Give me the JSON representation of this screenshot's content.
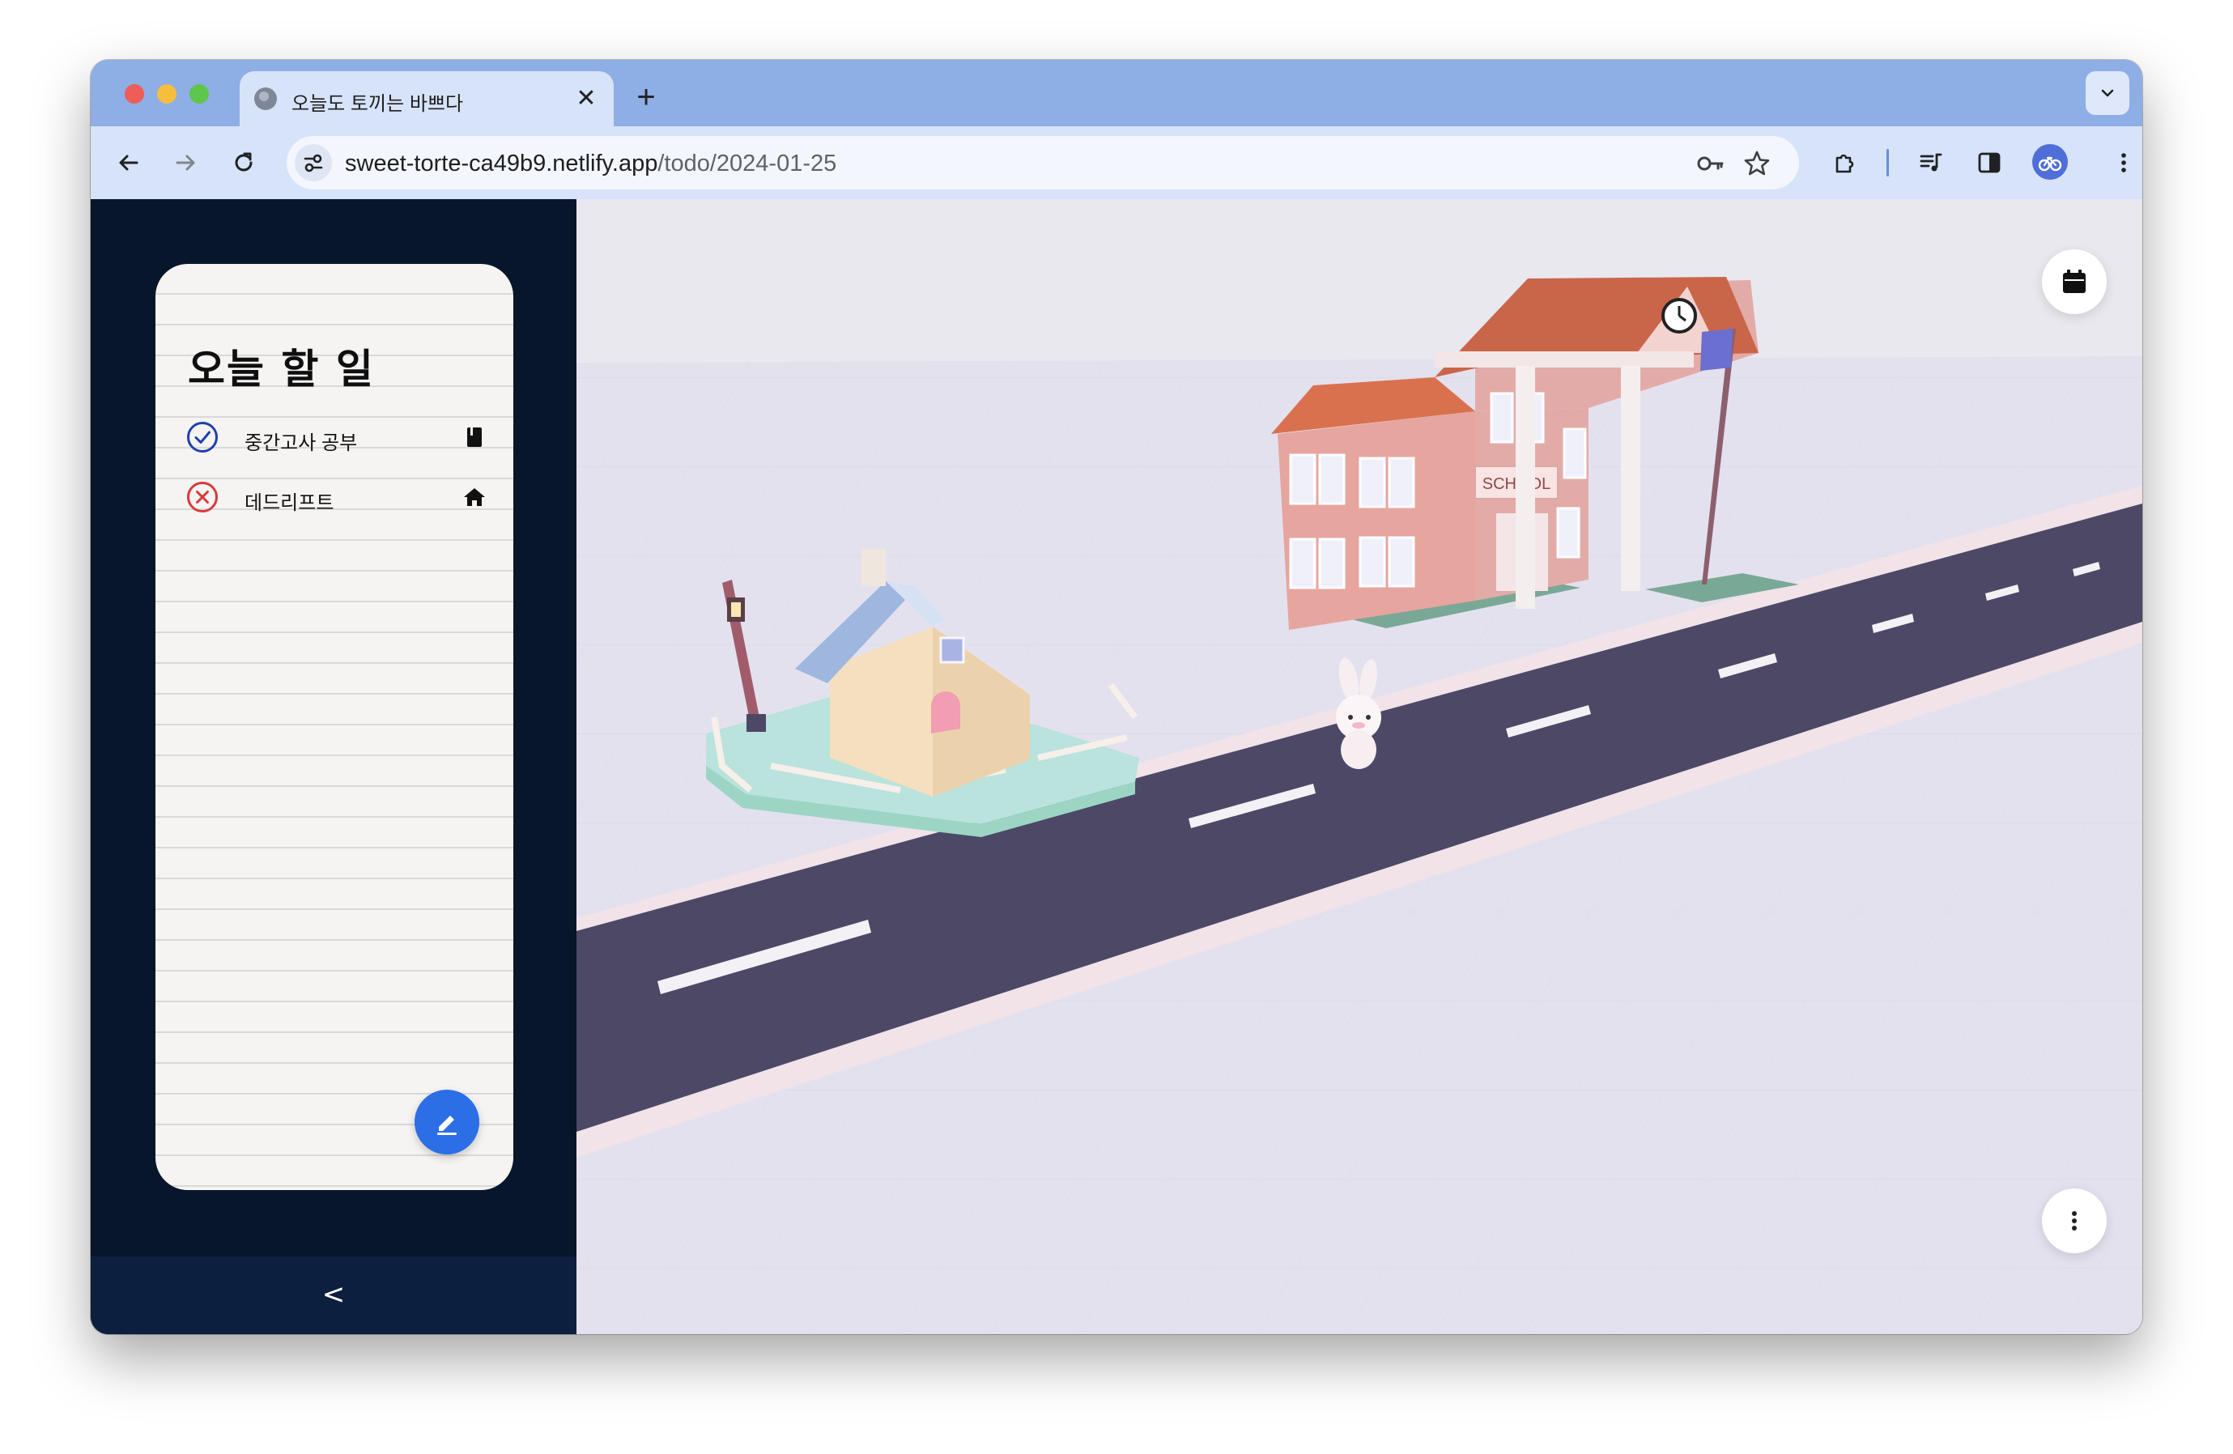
{
  "browser": {
    "tab_title": "오늘도 토끼는 바쁘다",
    "url_host": "sweet-torte-ca49b9.netlify.app",
    "url_path": "/todo/2024-01-25"
  },
  "todo": {
    "title": "오늘 할 일",
    "items": [
      {
        "text": "중간고사 공부",
        "status": "done",
        "category_icon": "book-icon"
      },
      {
        "text": "데드리프트",
        "status": "failed",
        "category_icon": "home-icon"
      }
    ]
  },
  "sidebar": {
    "collapse_label": "<"
  },
  "scene": {
    "school_sign": "SCHOOL",
    "colors": {
      "road": "#4c4866",
      "ground": "#e4e1ef",
      "sidebar": "#07162a",
      "accent": "#2b6ee6",
      "done": "#1f3fae",
      "failed": "#d83a3a"
    }
  }
}
